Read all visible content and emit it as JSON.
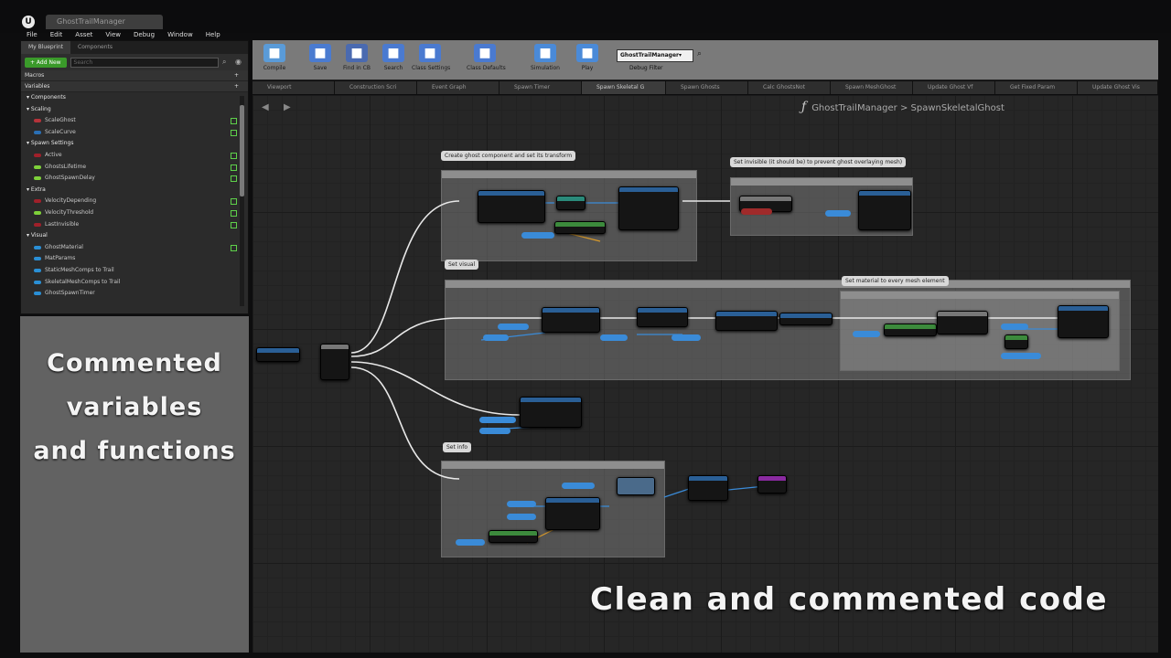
{
  "window": {
    "tab_title": "GhostTrailManager",
    "logo": "UE4"
  },
  "menu": [
    "File",
    "Edit",
    "Asset",
    "View",
    "Debug",
    "Window",
    "Help"
  ],
  "my_blueprint": {
    "tabs": [
      "My Blueprint",
      "Components"
    ],
    "add_new_label": "+ Add New",
    "search_placeholder": "Search",
    "macros_label": "Macros",
    "variables_label": "Variables",
    "tree": [
      {
        "label": "Components",
        "type": "group"
      },
      {
        "label": "Scaling",
        "type": "group"
      },
      {
        "label": "ScaleGhost",
        "color": "#b5333a",
        "eye": true
      },
      {
        "label": "ScaleCurve",
        "color": "#2a6fb5",
        "eye": true
      },
      {
        "label": "Spawn Settings",
        "type": "group"
      },
      {
        "label": "Active",
        "color": "#a0202a",
        "eye": true
      },
      {
        "label": "GhostsLifetime",
        "color": "#7ed13a",
        "eye": true
      },
      {
        "label": "GhostSpawnDelay",
        "color": "#7ed13a",
        "eye": true
      },
      {
        "label": "Extra",
        "type": "group"
      },
      {
        "label": "VelocityDepending",
        "color": "#a0202a",
        "eye": true
      },
      {
        "label": "VelocityThreshold",
        "color": "#7ed13a",
        "eye": true
      },
      {
        "label": "LastInvisible",
        "color": "#a0202a",
        "eye": true
      },
      {
        "label": "Visual",
        "type": "group"
      },
      {
        "label": "GhostMaterial",
        "color": "#2a8fd5",
        "eye": true
      },
      {
        "label": "MatParams",
        "color": "#2a8fd5",
        "eye": false
      },
      {
        "label": "StaticMeshComps to Trail",
        "color": "#2a8fd5",
        "eye": false
      },
      {
        "label": "SkeletalMeshComps to Trail",
        "color": "#2a8fd5",
        "eye": false
      },
      {
        "label": "GhostSpawnTimer",
        "color": "#2a8fd5",
        "eye": false
      }
    ]
  },
  "left_caption": [
    "Commented",
    "variables",
    "and functions"
  ],
  "toolbar": {
    "buttons": [
      {
        "label": "Compile",
        "icon": "compile-icon",
        "color": "#5a9bd8"
      },
      {
        "label": "Save",
        "icon": "save-icon",
        "color": "#4a7bd0"
      },
      {
        "label": "Find in CB",
        "icon": "find-in-cb-icon",
        "color": "#4a6ab0"
      },
      {
        "label": "Search",
        "icon": "search-icon",
        "color": "#4a7ad0"
      },
      {
        "label": "Class Settings",
        "icon": "class-settings-icon",
        "color": "#4a7ad0"
      },
      {
        "label": "Class Defaults",
        "icon": "class-defaults-icon",
        "color": "#4a7ad0"
      },
      {
        "label": "Simulation",
        "icon": "simulation-icon",
        "color": "#4a8ad8"
      },
      {
        "label": "Play",
        "icon": "play-icon",
        "color": "#4a8ad8"
      }
    ],
    "debug_object": "GhostTrailManager▾",
    "debug_filter_label": "Debug Filter"
  },
  "graph_tabs": [
    "Viewport",
    "Construction Scri",
    "Event Graph",
    "Spawn Timer",
    "Spawn Skeletal G",
    "Spawn Ghosts",
    "Calc GhostsNot",
    "Spawn MeshGhost",
    "Update Ghost Vf",
    "Get Fixed Param",
    "Update Ghost Vis"
  ],
  "active_graph_tab": 4,
  "graph": {
    "breadcrumb": "GhostTrailManager > SpawnSkeletalGhost",
    "comments": [
      "Create ghost component and set its transform",
      "Set invisible (it should be) to prevent ghost overlaying mesh)",
      "Set visual",
      "Set material to every mesh element",
      "Set info"
    ]
  },
  "right_caption": "Clean and commented code",
  "colors": {
    "accent_green": "#3a9a2a",
    "node_header_blue": "#2a5f96",
    "node_header_green": "#3c8a3c",
    "exec_white": "#e8e8e8",
    "data_blue": "#3a8bd8"
  }
}
